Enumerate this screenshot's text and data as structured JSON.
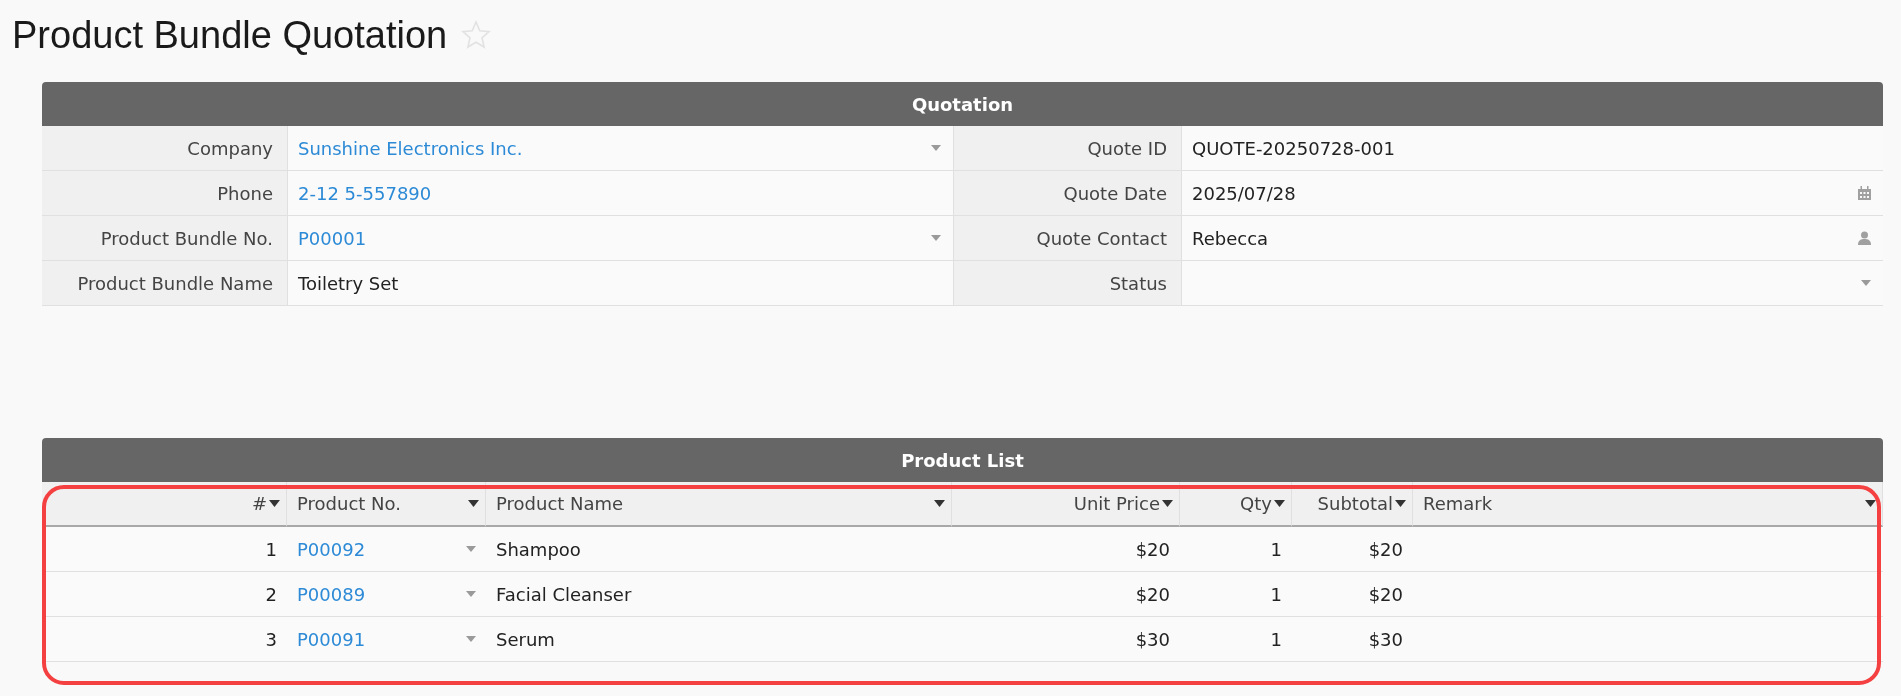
{
  "page": {
    "title": "Product Bundle Quotation",
    "starred": false
  },
  "quotation": {
    "title": "Quotation",
    "rows": [
      {
        "left": {
          "label": "Company",
          "value": "Sunshine Electronics Inc.",
          "link": true,
          "kind": "dropdown"
        },
        "right": {
          "label": "Quote ID",
          "value": "QUOTE-20250728-001",
          "link": false,
          "kind": "text"
        }
      },
      {
        "left": {
          "label": "Phone",
          "value": "2-12 5-557890",
          "link": true,
          "kind": "text"
        },
        "right": {
          "label": "Quote Date",
          "value": "2025/07/28",
          "link": false,
          "kind": "date"
        }
      },
      {
        "left": {
          "label": "Product Bundle No.",
          "value": "P00001",
          "link": true,
          "kind": "dropdown"
        },
        "right": {
          "label": "Quote Contact",
          "value": "Rebecca",
          "link": false,
          "kind": "user"
        }
      },
      {
        "left": {
          "label": "Product Bundle Name",
          "value": "Toiletry Set",
          "link": false,
          "kind": "text"
        },
        "right": {
          "label": "Status",
          "kind": "dropdown"
        }
      }
    ]
  },
  "product_list": {
    "title": "Product List",
    "highlighted": true,
    "columns": [
      {
        "label": "#",
        "kind": "number"
      },
      {
        "label": "Product No.",
        "kind": "link"
      },
      {
        "label": "Product Name",
        "kind": "text"
      },
      {
        "label": "Unit Price",
        "kind": "number"
      },
      {
        "label": "Qty",
        "kind": "number"
      },
      {
        "label": "Subtotal",
        "kind": "number"
      },
      {
        "label": "Remark",
        "kind": "text"
      }
    ],
    "rows": [
      [
        "1",
        "P00092",
        "Shampoo",
        "$20",
        "1",
        "$20",
        ""
      ],
      [
        "2",
        "P00089",
        "Facial Cleanser",
        "$20",
        "1",
        "$20",
        ""
      ],
      [
        "3",
        "P00091",
        "Serum",
        "$30",
        "1",
        "$30",
        ""
      ]
    ]
  }
}
